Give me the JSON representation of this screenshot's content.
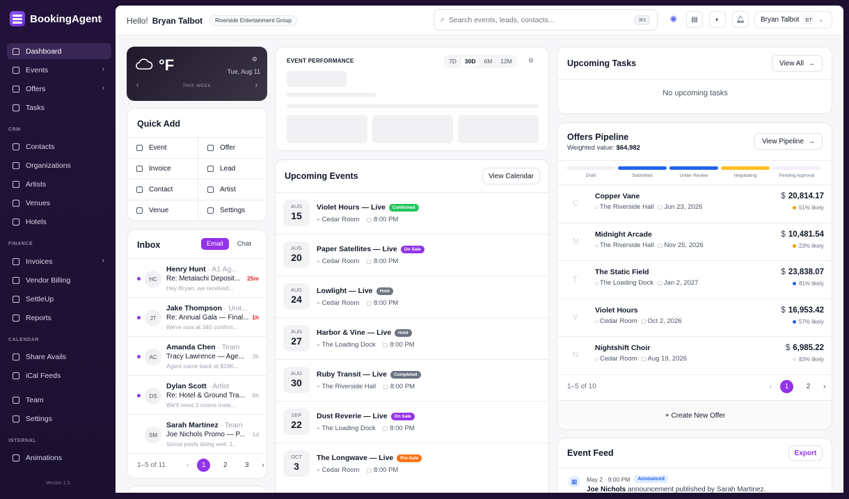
{
  "app": {
    "name": "BookingAgent",
    "version": "Version 1.0"
  },
  "sidebar": {
    "items": [
      {
        "label": "Dashboard",
        "top": 0
      },
      {
        "label": "Events"
      },
      {
        "label": "Offers"
      },
      {
        "label": "Tasks"
      }
    ],
    "sections": {
      "crm": "CRM",
      "finance": "FINANCE",
      "calendar": "CALENDAR",
      "internal": "INTERNAL"
    },
    "crm": [
      "Contacts",
      "Organizations",
      "Artists",
      "Venues",
      "Hotels"
    ],
    "finance": [
      "Invoices",
      "Vendor Billing",
      "SettleUp",
      "Reports"
    ],
    "calendar": [
      "Share Avails",
      "iCal Feeds"
    ],
    "misc": [
      "Team",
      "Settings"
    ],
    "internal": [
      "Animations"
    ]
  },
  "header": {
    "greeting": "Hello!",
    "user_name": "Bryan Talbot",
    "org": "Riverside Entertainment Group",
    "search_placeholder": "Search events, leads, contacts...",
    "search_kbd": "⌘K",
    "user_initials": "BT"
  },
  "weather": {
    "temp": "°F",
    "date": "Tue, Aug 11",
    "week": "THIS WEEK"
  },
  "quick_add": {
    "title": "Quick Add",
    "items": [
      "Event",
      "Offer",
      "Invoice",
      "Lead",
      "Contact",
      "Artist",
      "Venue",
      "Settings"
    ]
  },
  "inbox": {
    "title": "Inbox",
    "tabs": [
      "Email",
      "Chat"
    ],
    "messages": [
      {
        "initials": "HC",
        "name": "Henry Hunt",
        "org": "· A1 Ag...",
        "subject": "Re: Metalachi Deposit...",
        "preview": "Hey Bryan, we received...",
        "time": "25m",
        "urgent": true
      },
      {
        "initials": "JT",
        "name": "Jake Thompson",
        "org": "· Unit...",
        "subject": "Re: Annual Gala — Final...",
        "preview": "We're now at 340 confirm...",
        "time": "1h",
        "urgent": true
      },
      {
        "initials": "AC",
        "name": "Amanda Chen",
        "org": "· Team",
        "subject": "Tracy Lawrence — Age...",
        "preview": "Agent came back at $18K...",
        "time": "3h",
        "urgent": false
      },
      {
        "initials": "DS",
        "name": "Dylan Scott",
        "org": "· Artist",
        "subject": "Re: Hotel & Ground Tra...",
        "preview": "We'll need 3 rooms inste...",
        "time": "6h",
        "urgent": false
      },
      {
        "initials": "SM",
        "name": "Sarah Martinez",
        "org": "· Team",
        "subject": "Joe Nichols Promo — P...",
        "preview": "Social posts doing well. 1...",
        "time": "1d",
        "urgent": false
      }
    ],
    "pager": {
      "summary": "1–5 of 11",
      "pages": [
        "1",
        "2",
        "3"
      ]
    }
  },
  "performance": {
    "title": "EVENT PERFORMANCE",
    "ranges": [
      "7D",
      "30D",
      "6M",
      "12M"
    ],
    "active_range": "30D"
  },
  "events": {
    "title": "Upcoming Events",
    "button": "View Calendar",
    "items": [
      {
        "month": "AUG",
        "day": "15",
        "title": "Violet Hours — Live",
        "status": "Confirmed",
        "color": "#22c55e",
        "venue": "Cedar Room",
        "time": "8:00 PM"
      },
      {
        "month": "AUG",
        "day": "20",
        "title": "Paper Satellites — Live",
        "status": "On Sale",
        "color": "#9333ea",
        "venue": "Cedar Room",
        "time": "8:00 PM"
      },
      {
        "month": "AUG",
        "day": "24",
        "title": "Lowlight — Live",
        "status": "Hold",
        "color": "#6b7280",
        "venue": "Cedar Room",
        "time": "8:00 PM"
      },
      {
        "month": "AUG",
        "day": "27",
        "title": "Harbor & Vine — Live",
        "status": "Hold",
        "color": "#6b7280",
        "venue": "The Loading Dock",
        "time": "8:00 PM"
      },
      {
        "month": "AUG",
        "day": "30",
        "title": "Ruby Transit — Live",
        "status": "Completed",
        "color": "#6b7280",
        "venue": "The Riverside Hall",
        "time": "8:00 PM"
      },
      {
        "month": "SEP",
        "day": "22",
        "title": "Dust Reverie — Live",
        "status": "On Sale",
        "color": "#9333ea",
        "venue": "The Loading Dock",
        "time": "8:00 PM"
      },
      {
        "month": "OCT",
        "day": "3",
        "title": "The Longwave — Live",
        "status": "Pre-Sale",
        "color": "#f97316",
        "venue": "Cedar Room",
        "time": "8:00 PM"
      }
    ]
  },
  "tasks": {
    "title": "Upcoming Tasks",
    "button": "View All",
    "empty": "No upcoming tasks"
  },
  "pipeline": {
    "title": "Offers Pipeline",
    "weighted_label": "Weighted value:",
    "weighted_value": "$64,982",
    "button": "View Pipeline",
    "stages": [
      {
        "label": "Draft",
        "color": "#eef0f6"
      },
      {
        "label": "Submitted",
        "color": "#2563eb"
      },
      {
        "label": "Under Review",
        "color": "#2563eb"
      },
      {
        "label": "Negotiating",
        "color": "#fbbf24"
      },
      {
        "label": "Pending Approval",
        "color": "#f5eefc"
      }
    ],
    "deals": [
      {
        "initial": "C",
        "name": "Copper Vane",
        "venue": "The Riverside Hall",
        "date": "Jun 23, 2026",
        "currency": "$",
        "amount": "20,814.17",
        "likely": "51% likely",
        "dot": "#f59e0b"
      },
      {
        "initial": "M",
        "name": "Midnight Arcade",
        "venue": "The Riverside Hall",
        "date": "Nov 25, 2026",
        "currency": "$",
        "amount": "10,481.54",
        "likely": "23% likely",
        "dot": "#f59e0b"
      },
      {
        "initial": "T",
        "name": "The Static Field",
        "venue": "The Loading Dock",
        "date": "Jan 2, 2027",
        "currency": "$",
        "amount": "23,838.07",
        "likely": "81% likely",
        "dot": "#2563eb"
      },
      {
        "initial": "V",
        "name": "Violet Hours",
        "venue": "Cedar Room",
        "date": "Oct 2, 2026",
        "currency": "$",
        "amount": "16,953.42",
        "likely": "57% likely",
        "dot": "#2563eb"
      },
      {
        "initial": "N",
        "name": "Nightshift Choir",
        "venue": "Cedar Room",
        "date": "Aug 19, 2026",
        "currency": "$",
        "amount": "6,985.22",
        "likely": "83% likely",
        "dot": "#e5e7eb"
      }
    ],
    "pager": {
      "summary": "1–5 of 10",
      "pages": [
        "1",
        "2"
      ]
    },
    "create": "+ Create New Offer"
  },
  "feed": {
    "title": "Event Feed",
    "button": "Export",
    "item": {
      "date": "May 2 · 9:00 PM",
      "tag": "Announced",
      "actor": "Joe Nichols",
      "text": "announcement published by Sarah Martinez."
    }
  }
}
